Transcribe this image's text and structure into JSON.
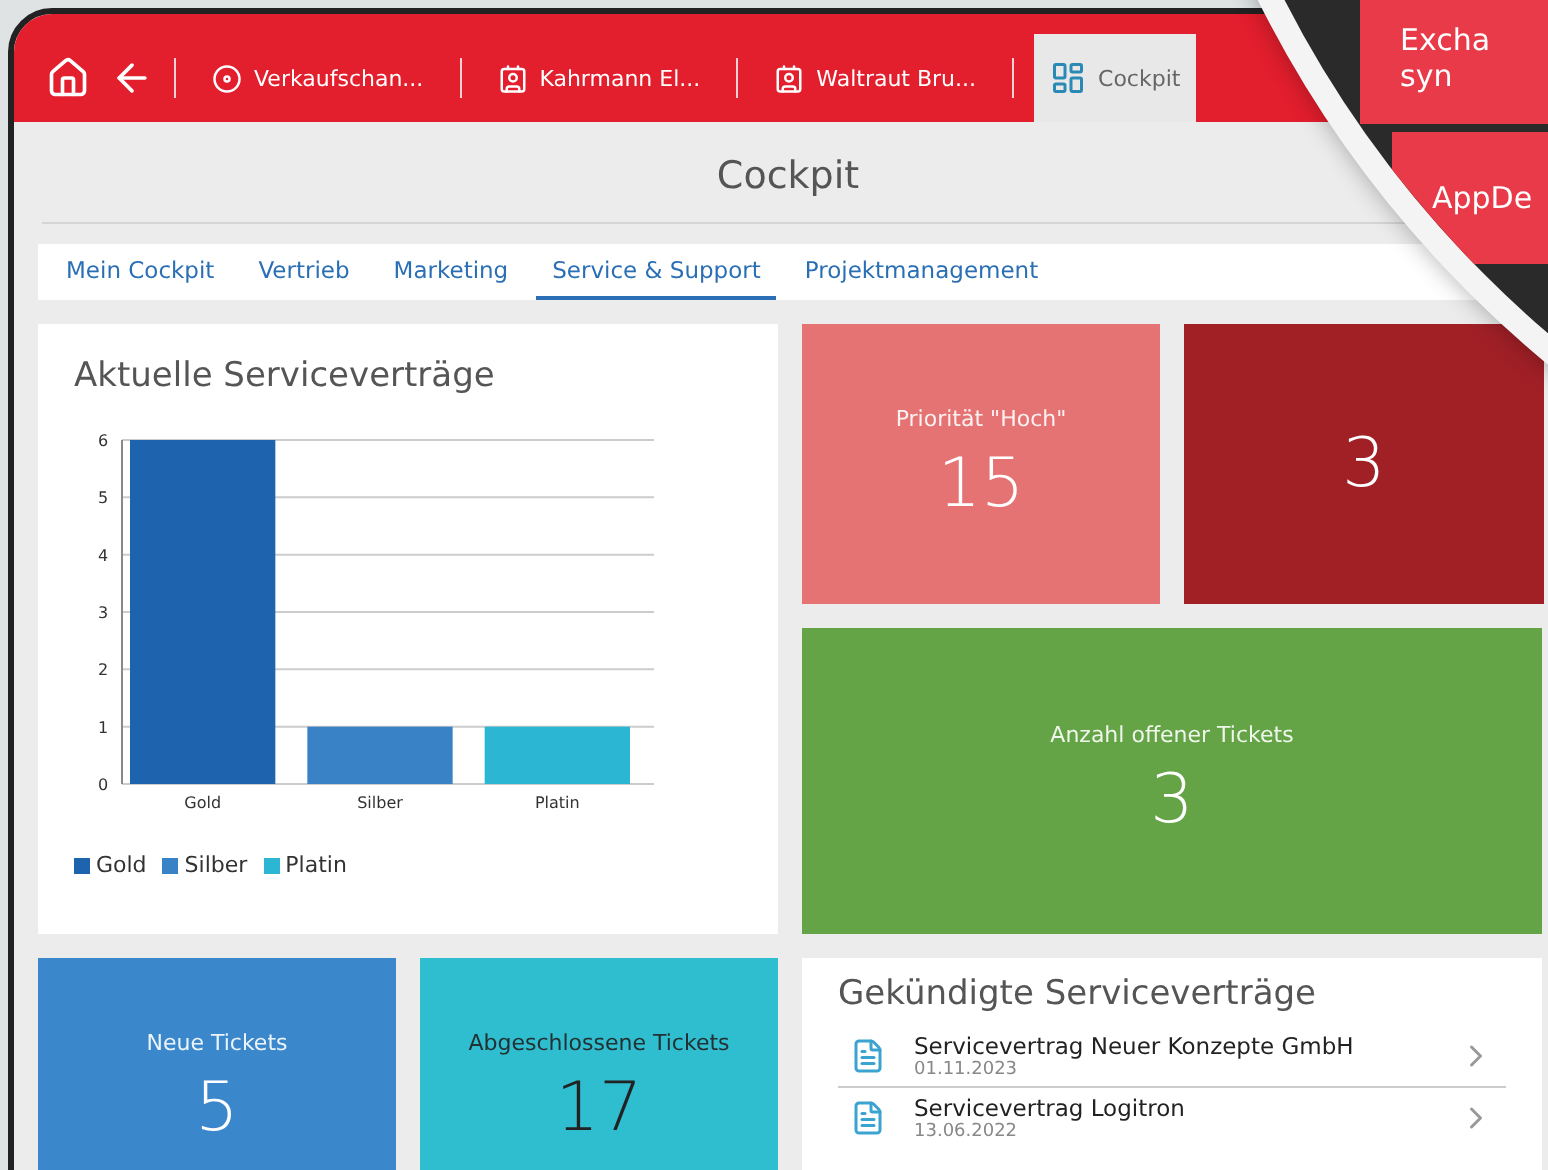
{
  "top_tabs": [
    {
      "kind": "record",
      "label": "Verkaufschan...",
      "selected": false
    },
    {
      "kind": "contact",
      "label": "Kahrmann El...",
      "selected": false
    },
    {
      "kind": "contact",
      "label": "Waltraut Bru...",
      "selected": false
    },
    {
      "kind": "cockpit",
      "label": "Cockpit",
      "selected": true
    }
  ],
  "title": "Cockpit",
  "tabs": [
    {
      "label": "Mein Cockpit",
      "selected": false
    },
    {
      "label": "Vertrieb",
      "selected": false
    },
    {
      "label": "Marketing",
      "selected": false
    },
    {
      "label": "Service & Support",
      "selected": true
    },
    {
      "label": "Projektmanagement",
      "selected": false
    }
  ],
  "chart_card": {
    "title": "Aktuelle Serviceverträge",
    "chart_data": {
      "type": "bar",
      "categories": [
        "Gold",
        "Silber",
        "Platin"
      ],
      "values": [
        6,
        1,
        1
      ],
      "ylim": [
        0,
        6
      ],
      "grid": true,
      "yticks": [
        0,
        1,
        2,
        3,
        4,
        5,
        6
      ]
    },
    "legend": [
      {
        "label": "Gold",
        "color": "#1e63ad"
      },
      {
        "label": "Silber",
        "color": "#3a82c6"
      },
      {
        "label": "Platin",
        "color": "#2bb6d3"
      }
    ]
  },
  "tiles_right": [
    {
      "label": "Priorität \"Hoch\"",
      "value": "15",
      "color": "#e57373"
    },
    {
      "value": "3",
      "color": "#a02026"
    }
  ],
  "open_tile": {
    "label": "Anzahl offener Tickets",
    "value": "3",
    "color": "#64a346"
  },
  "tiles_bottom": [
    {
      "label": "Neue Tickets",
      "value": "5",
      "color": "#3b87cc",
      "dark": false
    },
    {
      "label": "Abgeschlossene Tickets",
      "value": "17",
      "color": "#2fbdd0",
      "dark": true
    }
  ],
  "cancelled": {
    "title": "Gekündigte Serviceverträge",
    "items": [
      {
        "name": "Servicevertrag Neuer Konzepte GmbH",
        "date": "01.11.2023"
      },
      {
        "name": "Servicevertrag Logitron",
        "date": "13.06.2022"
      }
    ]
  },
  "magnifier": {
    "tiles": [
      {
        "lines": [
          "Excha",
          "syn"
        ]
      },
      {
        "lines": [
          "AppDe"
        ]
      }
    ]
  }
}
